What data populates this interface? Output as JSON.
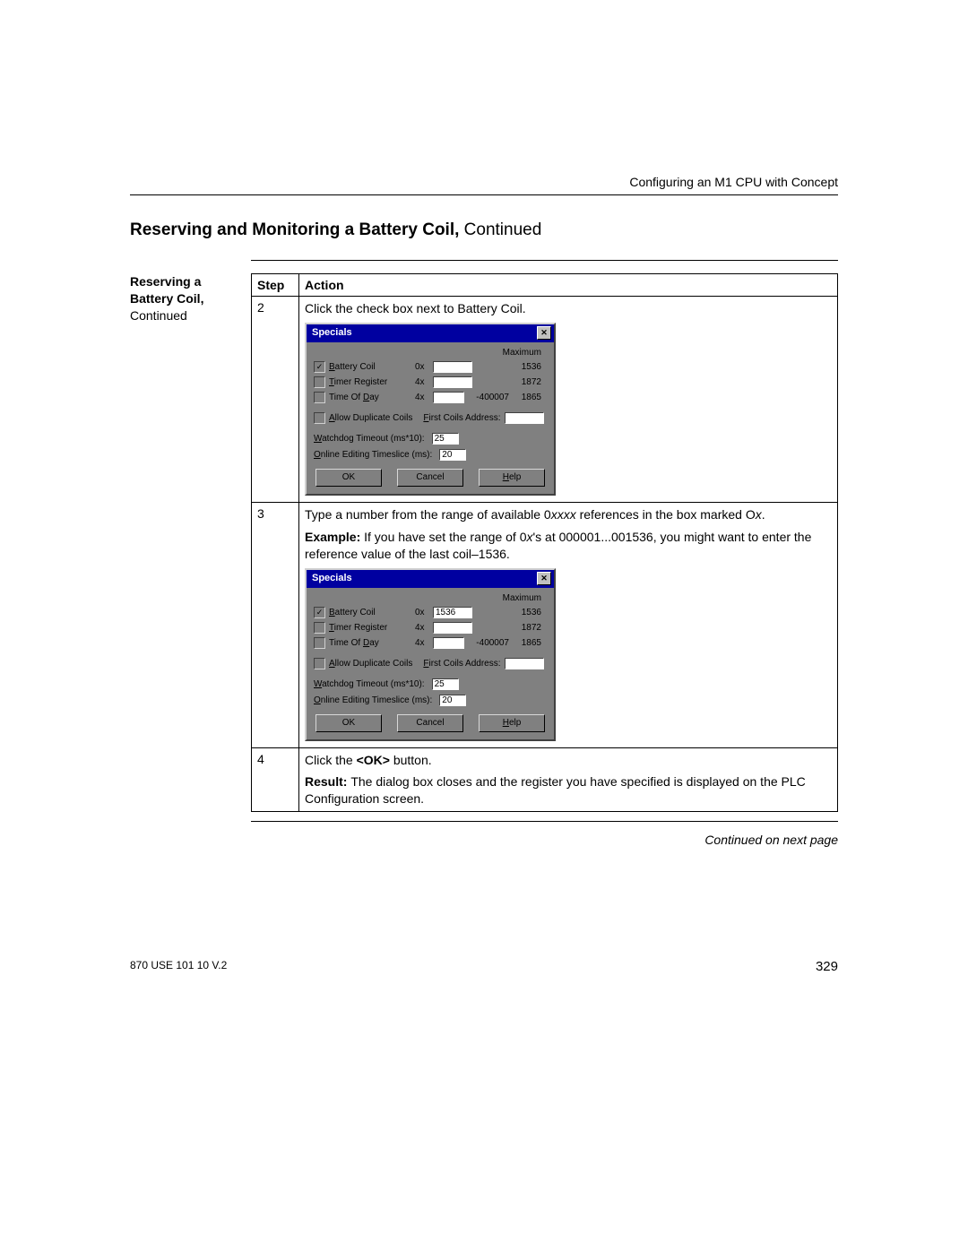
{
  "header": {
    "running": "Configuring an M1 CPU with Concept",
    "title_bold": "Reserving and Monitoring a Battery Coil, ",
    "title_rest": "Continued"
  },
  "sidebar": {
    "line1_bold": "Reserving a",
    "line2_bold": "Battery Coil,",
    "line3": "Continued"
  },
  "table": {
    "head_step": "Step",
    "head_action": "Action",
    "rows": [
      {
        "step": "2",
        "action_intro": "Click the check box next to Battery Coil.",
        "dialog_key": "dlg1"
      },
      {
        "step": "3",
        "paras": [
          {
            "plain_a": "Type a number from the range of available 0",
            "ital": "xxxx ",
            "plain_b": "references in the box marked O",
            "ital2": "x",
            "plain_c": "."
          },
          {
            "bold": "Example: ",
            "rest_a": "If you have set the range of 0",
            "ital": "x",
            "rest_b": "'s at 000001...001536, you might want to enter the reference value of the last coil–1536."
          }
        ],
        "dialog_key": "dlg2"
      },
      {
        "step": "4",
        "paras4": [
          {
            "a": "Click the ",
            "bold": "<OK>",
            "b": " button."
          },
          {
            "bold": "Result: ",
            "rest": "The dialog box closes and the register you have specified is displayed on the PLC Configuration screen."
          }
        ]
      }
    ]
  },
  "dlg1": {
    "title": "Specials",
    "close": "✕",
    "max_label": "Maximum",
    "r1": {
      "checked": true,
      "label_u": "B",
      "label_r": "attery Coil",
      "prefix": "0x",
      "value": "",
      "max": "1536"
    },
    "r2": {
      "checked": false,
      "label_u": "T",
      "label_r": "imer Register",
      "prefix": "4x",
      "value": "",
      "max": "1872"
    },
    "r3": {
      "checked": false,
      "label_pre": "Time Of ",
      "label_u": "D",
      "label_post": "ay",
      "prefix": "4x",
      "value": "",
      "suffix": "-400007",
      "max": "1865"
    },
    "dup": {
      "checked": false,
      "label_u": "A",
      "label_r": "llow Duplicate Coils",
      "fca_u": "F",
      "fca_r": "irst Coils Address:",
      "value": ""
    },
    "wd": {
      "label_u": "W",
      "label_r": "atchdog Timeout (ms*10):",
      "value": "25"
    },
    "oe": {
      "label_u": "O",
      "label_r": "nline Editing Timeslice (ms):",
      "value": "20"
    },
    "btn_ok": "OK",
    "btn_cancel": "Cancel",
    "btn_help_u": "H",
    "btn_help_r": "elp"
  },
  "dlg2": {
    "title": "Specials",
    "close": "✕",
    "max_label": "Maximum",
    "r1": {
      "checked": true,
      "label_u": "B",
      "label_r": "attery Coil",
      "prefix": "0x",
      "value": "1536",
      "max": "1536"
    },
    "r2": {
      "checked": false,
      "label_u": "T",
      "label_r": "imer Register",
      "prefix": "4x",
      "value": "",
      "max": "1872"
    },
    "r3": {
      "checked": false,
      "label_pre": "Time Of ",
      "label_u": "D",
      "label_post": "ay",
      "prefix": "4x",
      "value": "",
      "suffix": "-400007",
      "max": "1865"
    },
    "dup": {
      "checked": false,
      "label_u": "A",
      "label_r": "llow Duplicate Coils",
      "fca_u": "F",
      "fca_r": "irst Coils Address:",
      "value": ""
    },
    "wd": {
      "label_u": "W",
      "label_r": "atchdog Timeout (ms*10):",
      "value": "25"
    },
    "oe": {
      "label_u": "O",
      "label_r": "nline Editing Timeslice (ms):",
      "value": "20"
    },
    "btn_ok": "OK",
    "btn_cancel": "Cancel",
    "btn_help_u": "H",
    "btn_help_r": "elp"
  },
  "continued": "Continued on next page",
  "footer": {
    "doc": "870 USE 101 10 V.2",
    "page": "329"
  }
}
